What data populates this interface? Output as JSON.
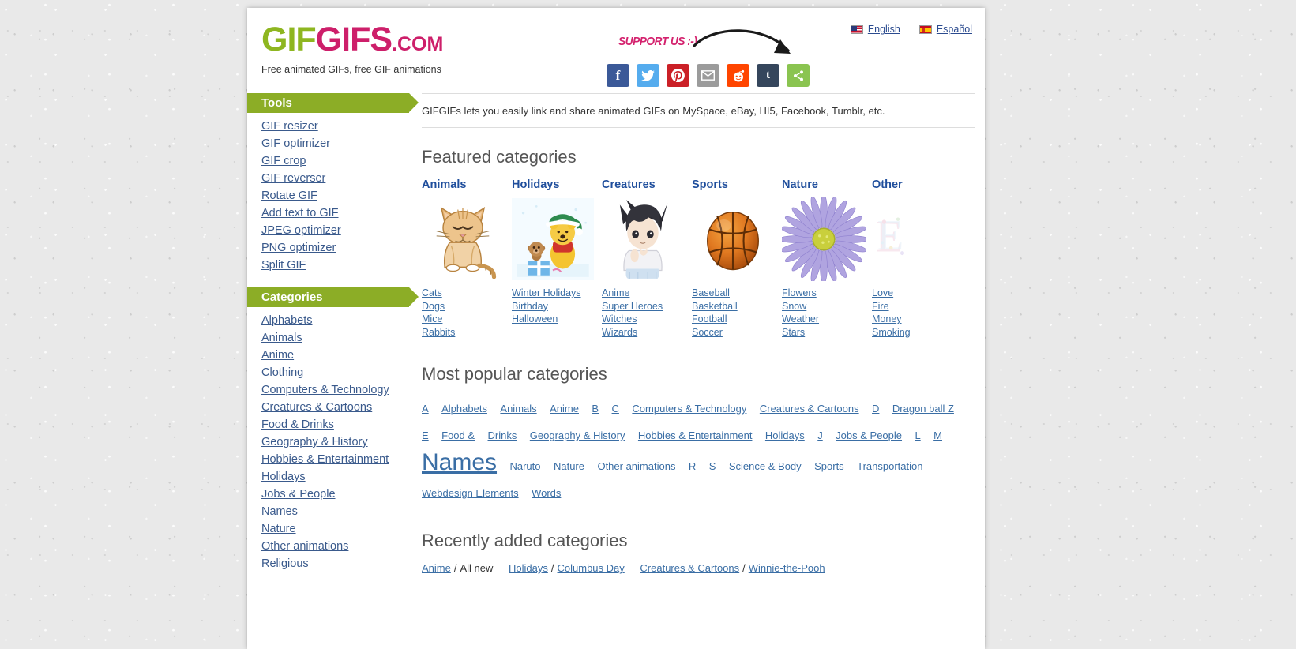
{
  "site": {
    "logo_part1": "GIF",
    "logo_part2": "GIFS",
    "logo_tld": ".COM",
    "tagline": "Free animated GIFs, free GIF animations",
    "support_text": "SUPPORT US :-)",
    "colors": {
      "green": "#8eb620",
      "pink": "#cd1f6a",
      "link": "#3a6ea5",
      "header_bar": "#8cad26"
    }
  },
  "languages": [
    {
      "label": "English",
      "flag": "us-flag-icon"
    },
    {
      "label": "Español",
      "flag": "es-flag-icon"
    }
  ],
  "share_buttons": [
    {
      "name": "facebook-share-button",
      "glyph": "f"
    },
    {
      "name": "twitter-share-button",
      "glyph": ""
    },
    {
      "name": "pinterest-share-button",
      "glyph": ""
    },
    {
      "name": "email-share-button",
      "glyph": ""
    },
    {
      "name": "reddit-share-button",
      "glyph": ""
    },
    {
      "name": "tumblr-share-button",
      "glyph": "t"
    },
    {
      "name": "more-share-button",
      "glyph": ""
    }
  ],
  "sidebar": {
    "tools_heading": "Tools",
    "tools": [
      "GIF resizer",
      "GIF optimizer",
      "GIF crop",
      "GIF reverser",
      "Rotate GIF",
      "Add text to GIF",
      "JPEG optimizer",
      "PNG optimizer",
      "Split GIF"
    ],
    "categories_heading": "Categories",
    "categories": [
      "Alphabets",
      "Animals",
      "Anime",
      "Clothing",
      "Computers & Technology",
      "Creatures & Cartoons",
      "Food & Drinks",
      "Geography & History",
      "Hobbies & Entertainment",
      "Holidays",
      "Jobs & People",
      "Names",
      "Nature",
      "Other animations",
      "Religious"
    ]
  },
  "main": {
    "intro": "GIFGIFs lets you easily link and share animated GIFs on MySpace, eBay, HI5, Facebook, Tumblr, etc.",
    "featured_heading": "Featured categories",
    "featured": [
      {
        "title": "Animals",
        "thumb": "cat-thumbnail",
        "links": [
          "Cats",
          "Dogs",
          "Mice",
          "Rabbits"
        ]
      },
      {
        "title": "Holidays",
        "thumb": "winnie-pooh-thumbnail",
        "links": [
          "Winter Holidays",
          "Birthday",
          "Halloween"
        ]
      },
      {
        "title": "Creatures",
        "thumb": "anime-boy-thumbnail",
        "links": [
          "Anime",
          "Super Heroes",
          "Witches",
          "Wizards"
        ]
      },
      {
        "title": "Sports",
        "thumb": "basketball-thumbnail",
        "links": [
          "Baseball",
          "Basketball",
          "Football",
          "Soccer"
        ]
      },
      {
        "title": "Nature",
        "thumb": "flower-thumbnail",
        "links": [
          "Flowers",
          "Snow",
          "Weather",
          "Stars"
        ]
      },
      {
        "title": "Other",
        "thumb": "letter-e-thumbnail",
        "links": [
          "Love",
          "Fire",
          "Money",
          "Smoking"
        ]
      }
    ],
    "popular_heading": "Most popular categories",
    "popular_tags": [
      {
        "label": "A",
        "size": "small"
      },
      {
        "label": "Alphabets",
        "size": "small"
      },
      {
        "label": "Animals",
        "size": "small"
      },
      {
        "label": "Anime",
        "size": "small"
      },
      {
        "label": "B",
        "size": "small"
      },
      {
        "label": "C",
        "size": "small"
      },
      {
        "label": "Computers & Technology",
        "size": "small"
      },
      {
        "label": "Creatures & Cartoons",
        "size": "small"
      },
      {
        "label": "D",
        "size": "small"
      },
      {
        "label": "Dragon ball Z",
        "size": "small"
      },
      {
        "label": "E",
        "size": "small"
      },
      {
        "label": "Food &",
        "size": "small"
      },
      {
        "label": "Drinks",
        "size": "small"
      },
      {
        "label": "Geography & History",
        "size": "small"
      },
      {
        "label": "Hobbies & Entertainment",
        "size": "small"
      },
      {
        "label": "Holidays",
        "size": "small"
      },
      {
        "label": "J",
        "size": "small"
      },
      {
        "label": "Jobs & People",
        "size": "small"
      },
      {
        "label": "L",
        "size": "small"
      },
      {
        "label": "M",
        "size": "small"
      },
      {
        "label": "Names",
        "size": "big"
      },
      {
        "label": "Naruto",
        "size": "small"
      },
      {
        "label": "Nature",
        "size": "small"
      },
      {
        "label": "Other animations",
        "size": "small"
      },
      {
        "label": "R",
        "size": "small"
      },
      {
        "label": "S",
        "size": "small"
      },
      {
        "label": "Science & Body",
        "size": "small"
      },
      {
        "label": "Sports",
        "size": "small"
      },
      {
        "label": "Transportation",
        "size": "small"
      },
      {
        "label": "Webdesign Elements",
        "size": "small"
      },
      {
        "label": "Words",
        "size": "small"
      }
    ],
    "recent_heading": "Recently added categories",
    "recent": [
      {
        "parent": "Anime",
        "separator": "/",
        "child": "All new",
        "child_is_link": false
      },
      {
        "parent": "Holidays",
        "separator": "/",
        "child": "Columbus Day",
        "child_is_link": true
      },
      {
        "parent": "Creatures & Cartoons",
        "separator": "/",
        "child": "Winnie-the-Pooh",
        "child_is_link": true
      }
    ]
  }
}
